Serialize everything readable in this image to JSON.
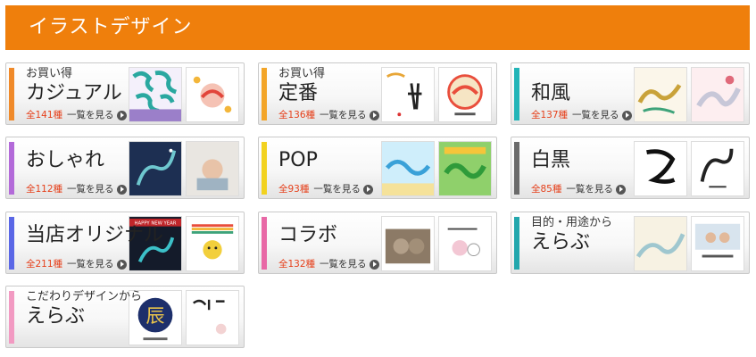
{
  "header": {
    "title": "イラストデザイン",
    "color": "#ef7f0c"
  },
  "cards": [
    {
      "id": "casual",
      "sub": "お買い得",
      "name": "カジュアル",
      "count": "全141種",
      "more": "一覧を見る",
      "accent": "#f08a2a"
    },
    {
      "id": "standard",
      "sub": "お買い得",
      "name": "定番",
      "count": "全136種",
      "more": "一覧を見る",
      "accent": "#f3a528"
    },
    {
      "id": "wafu",
      "sub": "",
      "name": "和風",
      "count": "全137種",
      "more": "一覧を見る",
      "accent": "#23b5b8"
    },
    {
      "id": "oshare",
      "sub": "",
      "name": "おしゃれ",
      "count": "全112種",
      "more": "一覧を見る",
      "accent": "#b36ad9"
    },
    {
      "id": "pop",
      "sub": "",
      "name": "POP",
      "count": "全93種",
      "more": "一覧を見る",
      "accent": "#f2d21f"
    },
    {
      "id": "shirokuro",
      "sub": "",
      "name": "白黒",
      "count": "全85種",
      "more": "一覧を見る",
      "accent": "#6b6b6b"
    },
    {
      "id": "original",
      "sub": "",
      "name": "当店オリジナル",
      "count": "全211種",
      "more": "一覧を見る",
      "accent": "#5a67e6"
    },
    {
      "id": "collab",
      "sub": "",
      "name": "コラボ",
      "count": "全132種",
      "more": "一覧を見る",
      "accent": "#e868a6"
    },
    {
      "id": "purpose",
      "sub": "目的・用途から",
      "name": "えらぶ",
      "count": "",
      "more": "",
      "accent": "#23a7ad"
    },
    {
      "id": "kodawari",
      "sub": "こだわりデザインから",
      "name": "えらぶ",
      "count": "",
      "more": "",
      "accent": "#f29ac2"
    }
  ],
  "thumbnail_labels": {
    "happy_new_year": "HAPPY NEW YEAR",
    "tatsu": "辰"
  },
  "icons": {
    "more_arrow": "circle-play-arrow-icon"
  }
}
